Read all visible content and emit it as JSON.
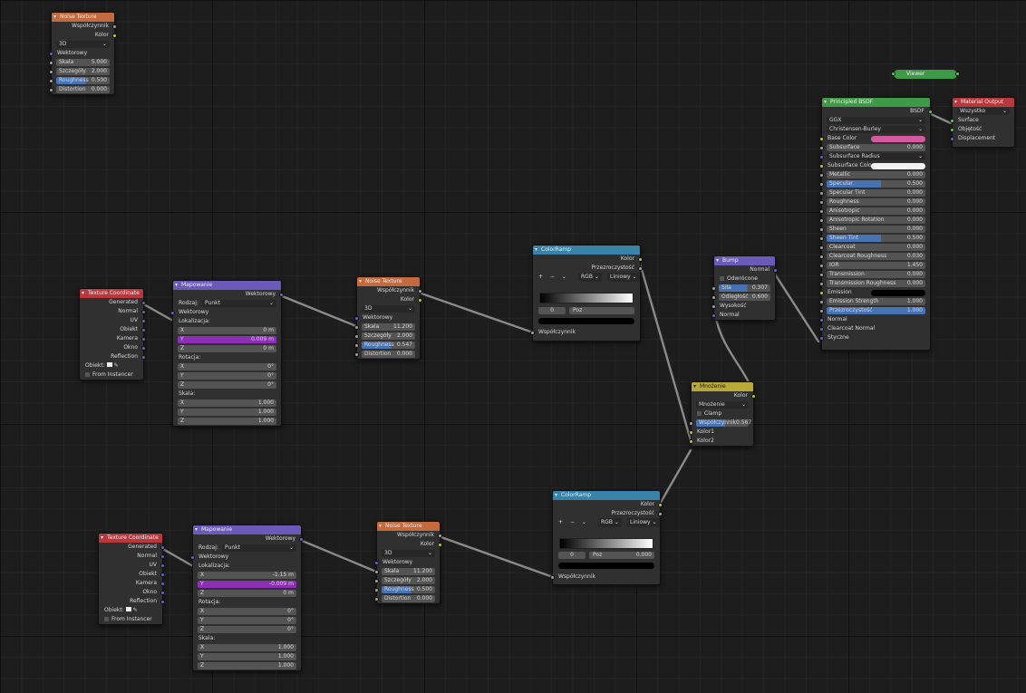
{
  "nodes": {
    "noise_top": {
      "title": "Noise Texture",
      "out1": "Współczynnik",
      "out2": "Kolor",
      "dim": "3D",
      "vec": "Wektorowy",
      "skala": "Skala",
      "skala_v": "5.000",
      "szcz": "Szczegóły",
      "szcz_v": "2.000",
      "rough": "Roughness",
      "rough_v": "0.500",
      "dist": "Distortion",
      "dist_v": "0.000"
    },
    "tc1": {
      "title": "Texture Coordinate",
      "outs": [
        "Generated",
        "Normal",
        "UV",
        "Obiekt",
        "Kamera",
        "Okno",
        "Reflection"
      ],
      "obiekt": "Obiekt:",
      "from": "From Instancer"
    },
    "map1": {
      "title": "Mapowanie",
      "out": "Wektorowy",
      "rodzaj": "Rodzaj:",
      "rodzaj_v": "Punkt",
      "wek": "Wektorowy",
      "lok": "Lokalizacja:",
      "x": "X",
      "y": "Y",
      "z": "Z",
      "lx": "0 m",
      "ly": "0.009 m",
      "lz": "0 m",
      "rot": "Rotacja:",
      "r": "0°",
      "skala": "Skala:",
      "s": "1.000"
    },
    "noise1": {
      "title": "Noise Texture",
      "out1": "Współczynnik",
      "out2": "Kolor",
      "dim": "3D",
      "vec": "Wektorowy",
      "skala": "Skala",
      "skala_v": "11.200",
      "szcz": "Szczegóły",
      "szcz_v": "2.000",
      "rough": "Roughness",
      "rough_v": "0.547",
      "dist": "Distortion",
      "dist_v": "0.000"
    },
    "ramp1": {
      "title": "ColorRamp",
      "out1": "Kolor",
      "out2": "Przezroczystość",
      "plus": "+",
      "minus": "−",
      "chev": "⌄",
      "mode": "RGB",
      "interp": "Liniowy",
      "idx": "0",
      "pos": "Poz",
      "pos_v": "",
      "in": "Współczynnik"
    },
    "bump": {
      "title": "Bump",
      "out": "Normal",
      "odw": "Odwrócone",
      "sila": "Siła",
      "sila_v": "0.307",
      "odl": "Odległość",
      "odl_v": "0.600",
      "wys": "Wysokość",
      "norm": "Normal"
    },
    "mix": {
      "title": "Mnożenie",
      "out": "Kolor",
      "op": "Mnożenie",
      "clamp": "Clamp",
      "wsp": "Współczynnik",
      "wsp_v": "0.567",
      "k1": "Kolor1",
      "k2": "Kolor2"
    },
    "viewer": {
      "title": "Viewer"
    },
    "bsdf": {
      "title": "Principled BSDF",
      "out": "BSDF",
      "dist": "GGX",
      "ss": "Christensen-Burley",
      "rows": [
        {
          "l": "Base Color",
          "t": "color",
          "c": "#d35a9e"
        },
        {
          "l": "Subsurface",
          "v": "0.000"
        },
        {
          "l": "Subsurface Radius",
          "t": "sel"
        },
        {
          "l": "Subsurface Colo",
          "t": "color",
          "c": "#f2f2f2"
        },
        {
          "l": "Metallic",
          "v": "0.000"
        },
        {
          "l": "Specular",
          "v": "0.500",
          "t": "blue"
        },
        {
          "l": "Specular Tint",
          "v": "0.000"
        },
        {
          "l": "Roughness",
          "v": "0.000"
        },
        {
          "l": "Anisotropic",
          "v": "0.000"
        },
        {
          "l": "Anisotropic Rotation",
          "v": "0.000"
        },
        {
          "l": "Sheen",
          "v": "0.000"
        },
        {
          "l": "Sheen Tint",
          "v": "0.500",
          "t": "blue"
        },
        {
          "l": "Clearcoat",
          "v": "0.000"
        },
        {
          "l": "Clearcoat Roughness",
          "v": "0.030"
        },
        {
          "l": "IOR",
          "v": "1.450"
        },
        {
          "l": "Transmission",
          "v": "0.000"
        },
        {
          "l": "Transmission Roughness",
          "v": "0.000"
        },
        {
          "l": "Emission",
          "t": "color",
          "c": "#000000"
        },
        {
          "l": "Emission Strength",
          "v": "1.000"
        },
        {
          "l": "Przezroczystość",
          "v": "1.000",
          "t": "full"
        },
        {
          "l": "Normal",
          "t": "sock"
        },
        {
          "l": "Clearcoat Normal",
          "t": "sock"
        },
        {
          "l": "Styczne",
          "t": "sock"
        }
      ]
    },
    "matout": {
      "title": "Material Output",
      "target": "Wszystko",
      "ins": [
        "Surface",
        "Objętość",
        "Displacement"
      ]
    },
    "ramp2": {
      "title": "ColorRamp",
      "out1": "Kolor",
      "out2": "Przezroczystość",
      "plus": "+",
      "minus": "−",
      "chev": "⌄",
      "mode": "RGB",
      "interp": "Liniowy",
      "idx": "0",
      "pos": "Poz",
      "pos_v": "0.000",
      "in": "Współczynnik"
    },
    "tc2": {
      "title": "Texture Coordinate",
      "outs": [
        "Generated",
        "Normal",
        "UV",
        "Obiekt",
        "Kamera",
        "Okno",
        "Reflection"
      ],
      "obiekt": "Obiekt:",
      "from": "From Instancer"
    },
    "map2": {
      "title": "Mapowanie",
      "out": "Wektorowy",
      "rodzaj": "Rodzaj:",
      "rodzaj_v": "Punkt",
      "wek": "Wektorowy",
      "lok": "Lokalizacja:",
      "x": "X",
      "y": "Y",
      "z": "Z",
      "lx": "-1.15 m",
      "ly": "-0.009 m",
      "lz": "0 m",
      "rot": "Rotacja:",
      "r": "0°",
      "skala": "Skala:",
      "s": "1.000"
    },
    "noise2": {
      "title": "Noise Texture",
      "out1": "Współczynnik",
      "out2": "Kolor",
      "dim": "3D",
      "vec": "Wektorowy",
      "skala": "Skala",
      "skala_v": "11.200",
      "szcz": "Szczegóły",
      "szcz_v": "2.000",
      "rough": "Roughness",
      "rough_v": "0.500",
      "dist": "Distortion",
      "dist_v": "0.000"
    }
  },
  "colors": {
    "texture_header": "#c36a3e",
    "vector_header": "#6b5ab8",
    "input_header": "#b8383e",
    "converter_header": "#3a82a8",
    "shader_header": "#3f9a48",
    "socket_yellow": "#c7c729",
    "socket_gray": "#a1a1a1",
    "socket_blue": "#6363c7"
  }
}
